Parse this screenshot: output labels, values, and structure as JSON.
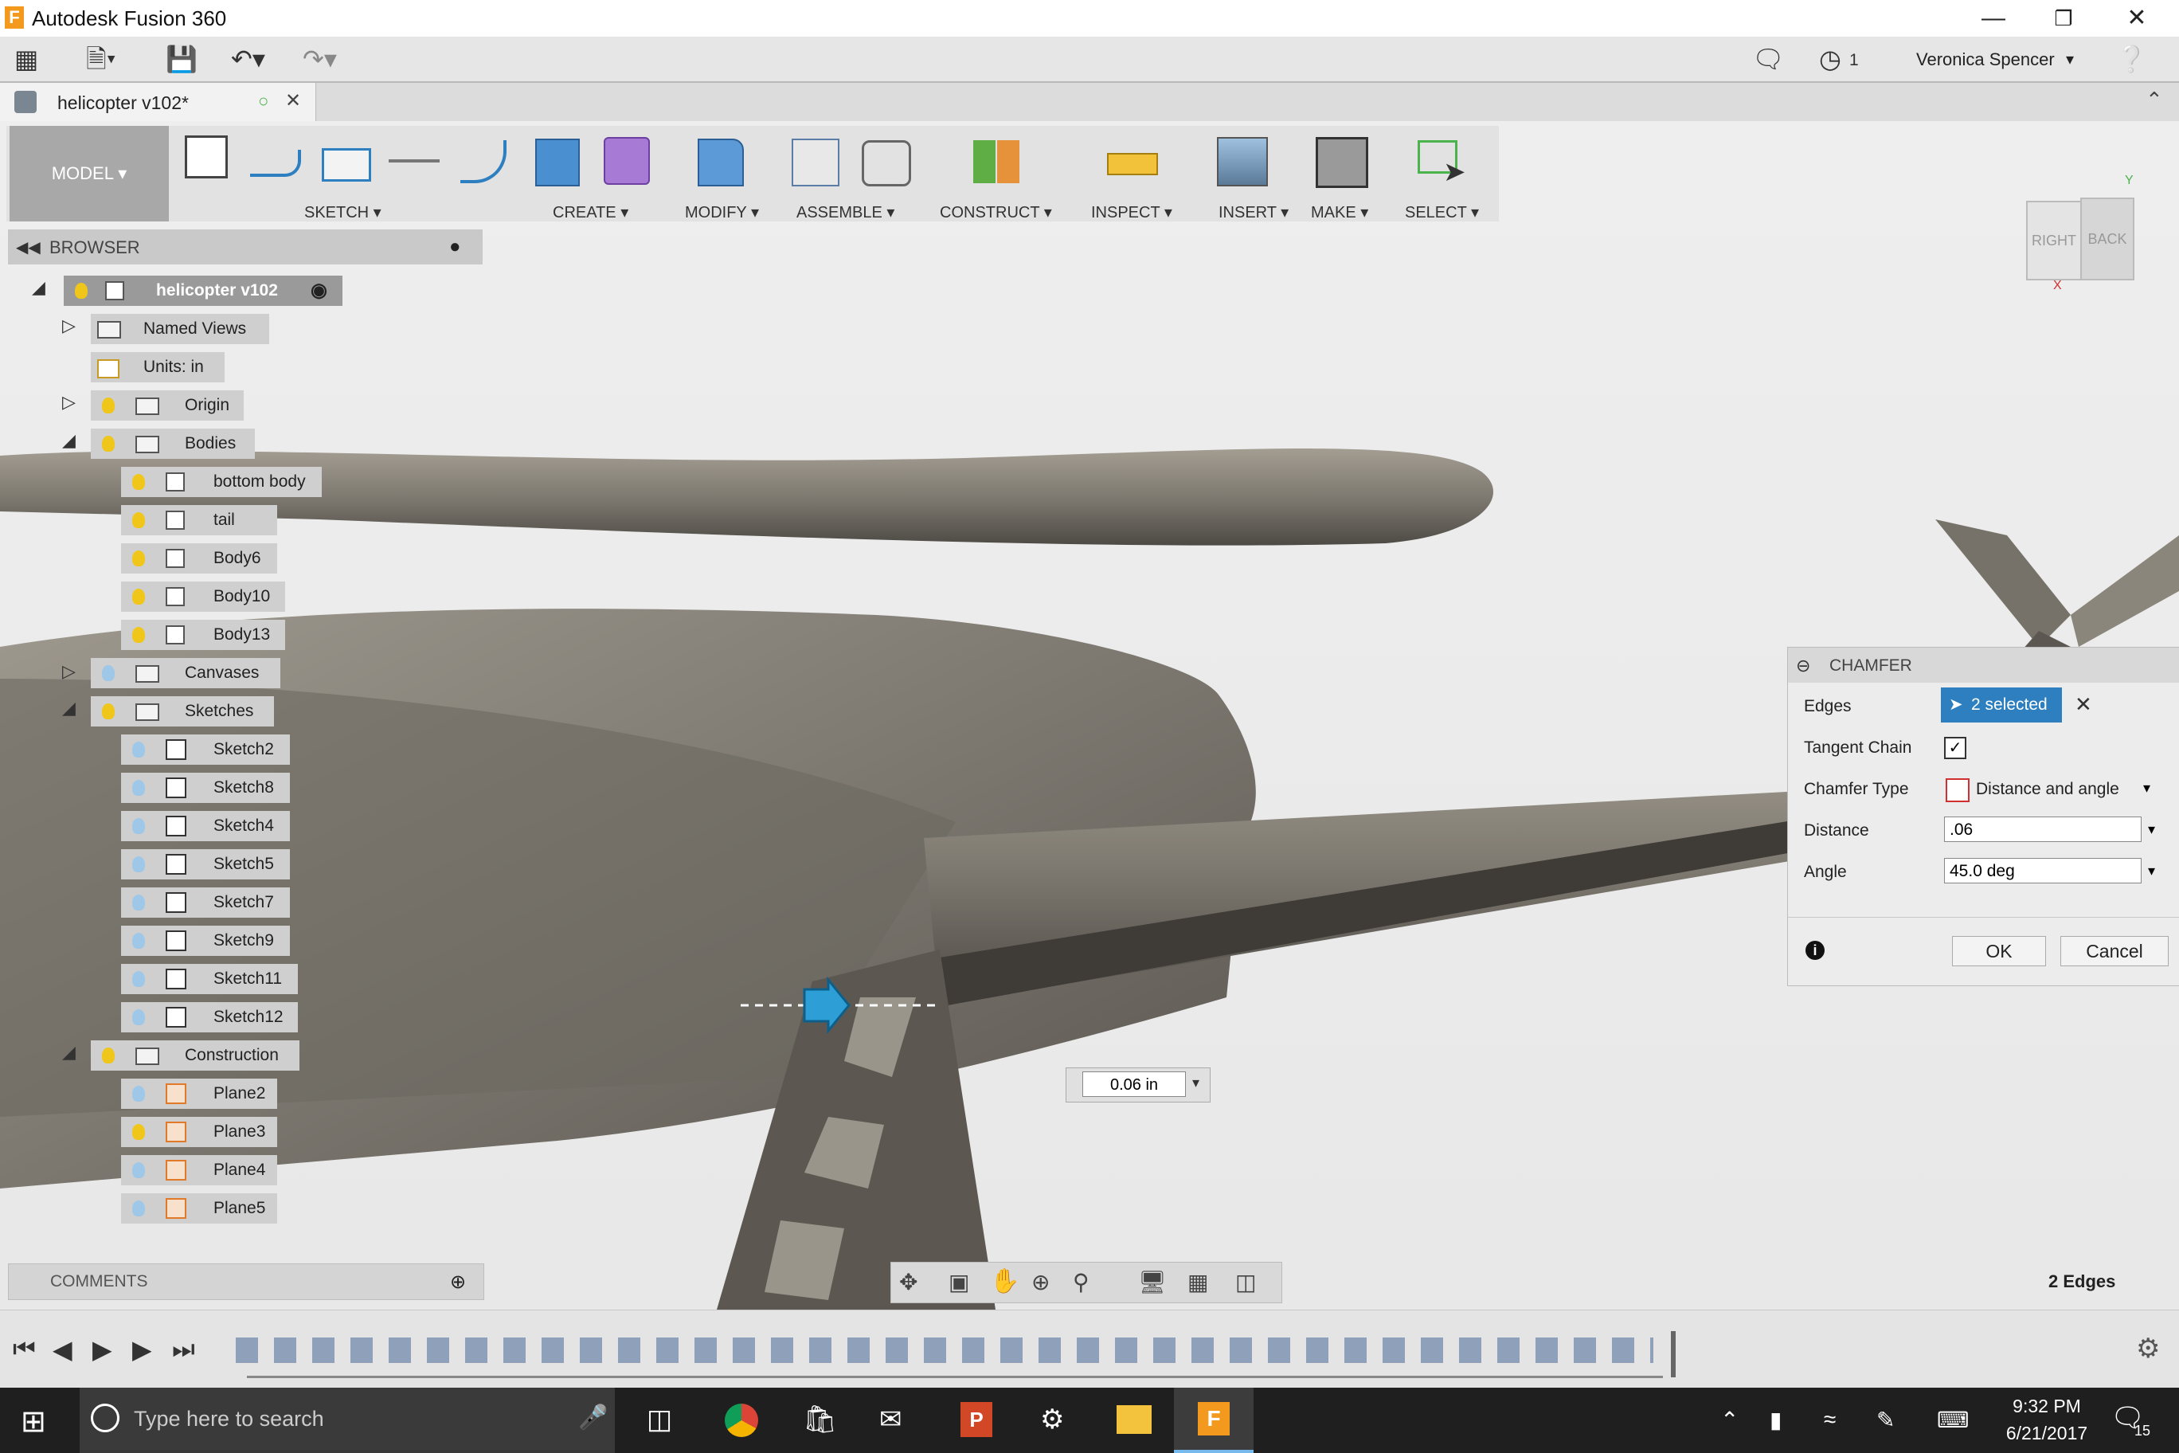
{
  "window": {
    "title": "Autodesk Fusion 360",
    "logo": "F"
  },
  "quickaccess": {
    "notifications": "1",
    "user": "Veronica Spencer"
  },
  "document": {
    "tab": "helicopter v102*"
  },
  "toolbar": {
    "workspace": "MODEL ▾",
    "groups": [
      "SKETCH ▾",
      "CREATE ▾",
      "MODIFY ▾",
      "ASSEMBLE ▾",
      "CONSTRUCT ▾",
      "INSPECT ▾",
      "INSERT ▾",
      "MAKE ▾",
      "SELECT ▾"
    ]
  },
  "viewcube": {
    "right": "RIGHT",
    "back": "BACK",
    "x": "X",
    "y": "Y"
  },
  "browser": {
    "title": "BROWSER",
    "root": "helicopter v102",
    "named_views": "Named Views",
    "units": "Units: in",
    "origin": "Origin",
    "bodies": "Bodies",
    "body_items": [
      "bottom body",
      "tail",
      "Body6",
      "Body10",
      "Body13"
    ],
    "canvases": "Canvases",
    "sketches": "Sketches",
    "sketch_items": [
      "Sketch2",
      "Sketch8",
      "Sketch4",
      "Sketch5",
      "Sketch7",
      "Sketch9",
      "Sketch11",
      "Sketch12"
    ],
    "construction": "Construction",
    "plane_items": [
      "Plane2",
      "Plane3",
      "Plane4",
      "Plane5"
    ]
  },
  "comments": {
    "title": "COMMENTS"
  },
  "dimension_input": "0.06 in",
  "selection_status": "2 Edges",
  "chamfer": {
    "title": "CHAMFER",
    "edges_label": "Edges",
    "edges_value": "2 selected",
    "tangent_label": "Tangent Chain",
    "type_label": "Chamfer Type",
    "type_value": "Distance and angle",
    "distance_label": "Distance",
    "distance_value": ".06",
    "angle_label": "Angle",
    "angle_value": "45.0 deg",
    "ok": "OK",
    "cancel": "Cancel"
  },
  "taskbar": {
    "search_placeholder": "Type here to search",
    "time": "9:32 PM",
    "date": "6/21/2017",
    "notif_count": "15"
  },
  "colors": {
    "accent": "#2d7fc0",
    "bulb_on": "#f0c61a",
    "bulb_off": "#9fc7e8",
    "plane": "#e07a28"
  }
}
